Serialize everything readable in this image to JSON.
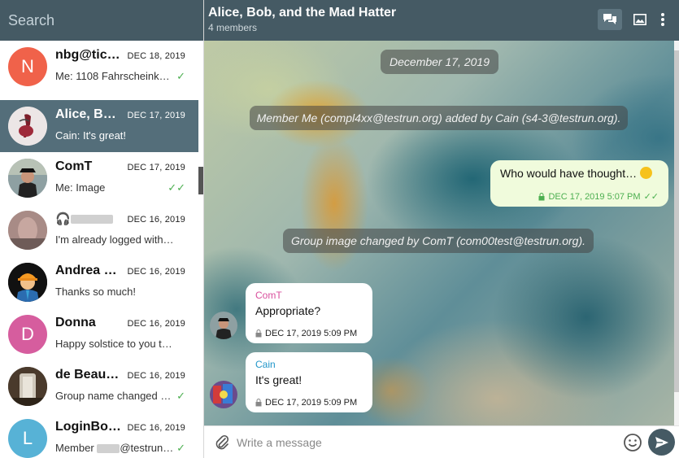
{
  "search": {
    "placeholder": "Search"
  },
  "chats": [
    {
      "name": "nbg@tick…",
      "date": "DEC 18, 2019",
      "preview": "Me: 1108 Fahrscheink…",
      "avatar_letter": "N",
      "avatar_color": "#f0624a",
      "status": "sent"
    },
    {
      "name": "Alice, Bob,…",
      "date": "DEC 17, 2019",
      "preview": "Cain: It's great!",
      "avatar_letter": "",
      "status": "",
      "active": true
    },
    {
      "name": "ComT",
      "date": "DEC 17, 2019",
      "preview": "Me: Image",
      "avatar_letter": "",
      "status": "read"
    },
    {
      "name": "",
      "date": "DEC 16, 2019",
      "preview": "I'm already logged with…",
      "avatar_letter": "",
      "status": ""
    },
    {
      "name": "Andrea Gu…",
      "date": "DEC 16, 2019",
      "preview": "Thanks so much!",
      "avatar_letter": "",
      "status": ""
    },
    {
      "name": "Donna",
      "date": "DEC 16, 2019",
      "preview": "Happy solstice to you t…",
      "avatar_letter": "D",
      "avatar_color": "#d65d9e",
      "status": ""
    },
    {
      "name": "de Beauvo…",
      "date": "DEC 16, 2019",
      "preview": "Group name changed …",
      "avatar_letter": "",
      "status": "sent"
    },
    {
      "name": "LoginBot …",
      "date": "DEC 16, 2019",
      "preview_prefix": "Member",
      "preview_suffix": "@testrun…",
      "avatar_letter": "L",
      "avatar_color": "#57b2d6",
      "status": "sent"
    }
  ],
  "header": {
    "title": "Alice, Bob, and the Mad Hatter",
    "subtitle": "4 members"
  },
  "messages": {
    "date_pill": "December 17, 2019",
    "member_added": "Member Me (compl4xx@testrun.org) added by Cain (s4-3@testrun.org).",
    "outgoing": {
      "text": "Who would have thought…",
      "meta": "DEC 17, 2019 5:07 PM"
    },
    "group_image_changed": "Group image changed by ComT (com00test@testrun.org).",
    "incoming": [
      {
        "sender": "ComT",
        "sender_color": "#d94f9d",
        "text": "Appropriate?",
        "meta": "DEC 17, 2019 5:09 PM"
      },
      {
        "sender": "Cain",
        "sender_color": "#2196c9",
        "text": "It's great!",
        "meta": "DEC 17, 2019 5:09 PM"
      }
    ]
  },
  "composer": {
    "placeholder": "Write a message"
  },
  "icons": {
    "gallery": "chat-bubbles-icon",
    "image": "image-icon",
    "menu": "more-vertical-icon",
    "attach": "paperclip-icon",
    "emoji": "smiley-icon",
    "send": "send-icon",
    "lock": "lock-icon",
    "tick": "check-icon",
    "headphones": "headphones-icon"
  },
  "colors": {
    "header": "#455a64",
    "active_item": "#546e7a",
    "outgoing_bubble": "#f0fbdc",
    "tick_green": "#4caf50"
  }
}
